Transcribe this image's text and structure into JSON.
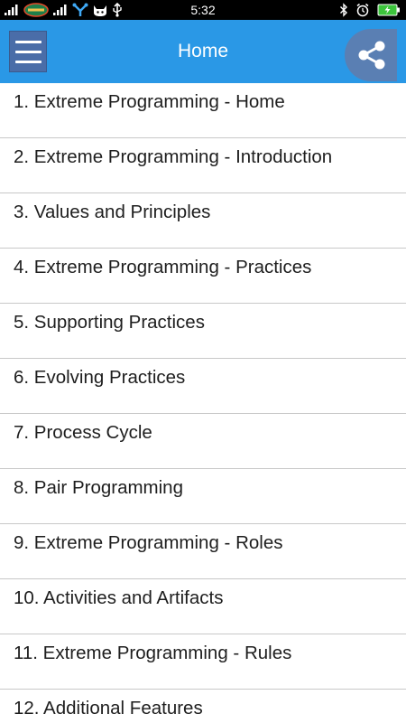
{
  "status_bar": {
    "time": "5:32",
    "carrier_badge": "Mobitel",
    "battery_color": "#3cc43c",
    "icons": [
      "signal-icon",
      "carrier-badge-icon",
      "signal-icon",
      "usb-share-icon",
      "cat-icon",
      "usb-icon",
      "bluetooth-icon",
      "alarm-icon",
      "battery-charging-icon"
    ]
  },
  "app_bar": {
    "title": "Home",
    "menu_icon": "hamburger-menu-icon",
    "share_icon": "share-icon",
    "background_color": "#2a98e6"
  },
  "list": {
    "items": [
      {
        "label": "1. Extreme Programming - Home"
      },
      {
        "label": "2. Extreme Programming - Introduction"
      },
      {
        "label": "3. Values and Principles"
      },
      {
        "label": "4. Extreme Programming - Practices"
      },
      {
        "label": "5. Supporting Practices"
      },
      {
        "label": "6. Evolving Practices"
      },
      {
        "label": "7. Process Cycle"
      },
      {
        "label": "8. Pair Programming"
      },
      {
        "label": "9. Extreme Programming - Roles"
      },
      {
        "label": "10. Activities and Artifacts"
      },
      {
        "label": "11. Extreme Programming - Rules"
      },
      {
        "label": "12. Additional Features"
      }
    ]
  }
}
